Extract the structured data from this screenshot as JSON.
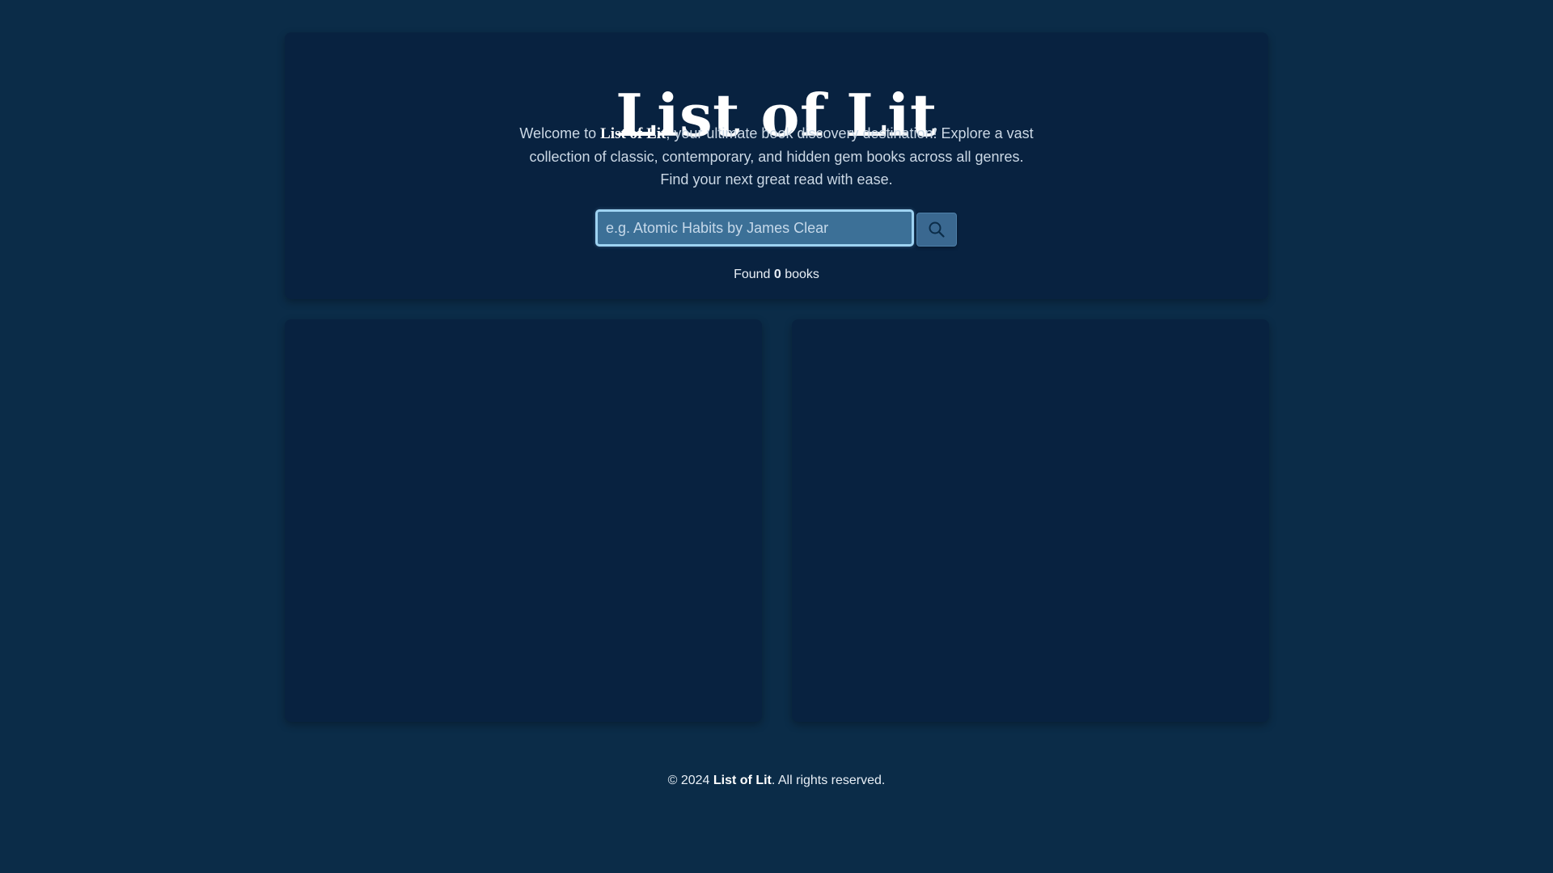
{
  "header": {
    "title": "List of Lit",
    "description_prefix": "Welcome to ",
    "description_brand": "List of Lit",
    "description_suffix": ", your ultimate book discovery destination! Explore a vast collection of classic, contemporary, and hidden gem books across all genres. Find your next great read with ease."
  },
  "search": {
    "placeholder": "e.g. Atomic Habits by James Clear",
    "value": "",
    "button_icon": "search-icon"
  },
  "results": {
    "prefix": "Found ",
    "count": "0",
    "suffix": " books"
  },
  "book_cards": [
    {
      "content": ""
    },
    {
      "content": ""
    }
  ],
  "footer": {
    "prefix": "© 2024 ",
    "brand": "List of Lit",
    "suffix": ". All rights reserved."
  },
  "colors": {
    "background": "#0b2c48",
    "card": "#082240",
    "input_background": "#3c7097",
    "input_border": "#9ed3f2",
    "button": "#3a6890",
    "text": "#ffffff"
  }
}
